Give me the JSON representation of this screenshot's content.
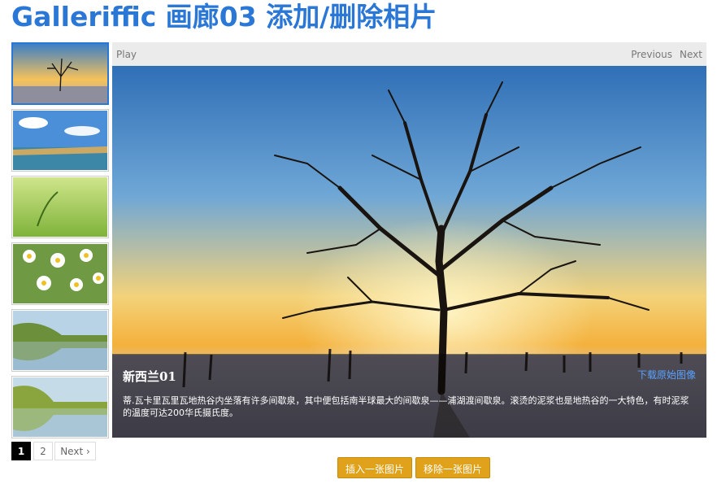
{
  "page": {
    "title": "Galleriffic 画廊03 添加/删除相片"
  },
  "thumbnails": [
    {
      "name": "tree-sunset",
      "selected": true
    },
    {
      "name": "sky-lake",
      "selected": false
    },
    {
      "name": "green-grass",
      "selected": false
    },
    {
      "name": "daisies",
      "selected": false
    },
    {
      "name": "lake-reflection",
      "selected": false
    },
    {
      "name": "lake-reflection-2",
      "selected": false
    }
  ],
  "pagination": {
    "pages": [
      "1",
      "2"
    ],
    "current": "1",
    "next_label": "Next ›"
  },
  "controls": {
    "play_label": "Play",
    "previous_label": "Previous",
    "next_label": "Next"
  },
  "slide": {
    "caption_title": "新西兰01",
    "download_label": "下载原始图像",
    "description": "蒂.瓦卡里瓦里瓦地热谷内坐落有许多间歇泉，其中便包括南半球最大的间歇泉——浦湖渡间歇泉。滚烫的泥浆也是地热谷的一大特色，有时泥浆的温度可达200华氏摄氏度。"
  },
  "actions": {
    "insert_label": "插入一张图片",
    "remove_label": "移除一张图片"
  },
  "colors": {
    "accent": "#2a77d6",
    "button": "#e0a21a"
  }
}
